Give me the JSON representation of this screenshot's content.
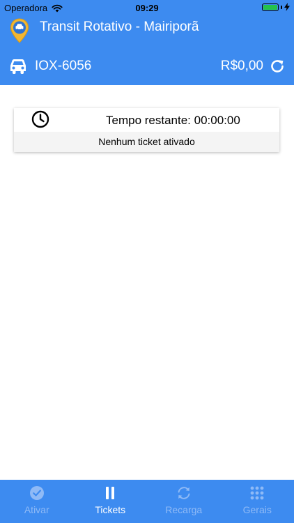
{
  "status_bar": {
    "carrier": "Operadora",
    "time": "09:29"
  },
  "app": {
    "title": "Transit Rotativo - Mairiporã"
  },
  "vehicle": {
    "plate": "IOX-6056",
    "balance": "R$0,00"
  },
  "ticket": {
    "time_remaining": "Tempo restante: 00:00:00",
    "status": "Nenhum ticket ativado"
  },
  "tabs": [
    {
      "label": "Ativar",
      "icon": "check-circle-icon",
      "active": false
    },
    {
      "label": "Tickets",
      "icon": "pause-icon",
      "active": true
    },
    {
      "label": "Recarga",
      "icon": "sync-icon",
      "active": false
    },
    {
      "label": "Gerais",
      "icon": "grid-icon",
      "active": false
    }
  ],
  "colors": {
    "primary": "#3d8bf0",
    "tab_inactive": "#8fbaf6",
    "tab_active": "#ffffff",
    "battery": "#24c24a"
  }
}
